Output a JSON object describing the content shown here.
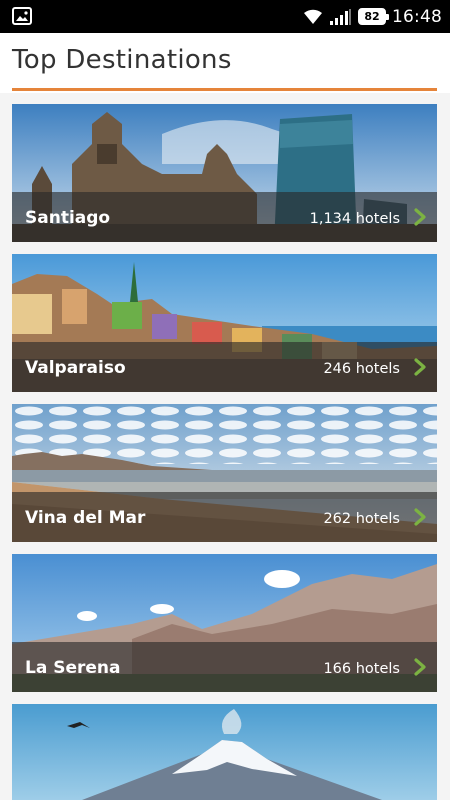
{
  "status_bar": {
    "time": "16:48",
    "battery": "82",
    "left_icon": "image-icon",
    "wifi_icon": "wifi-icon",
    "signal_icon": "signal-icon"
  },
  "header": {
    "title": "Top Destinations",
    "accent_color": "#e5843a"
  },
  "destinations": [
    {
      "name": "Santiago",
      "hotels": "1,134 hotels",
      "chevron_icon": "chevron-right-icon"
    },
    {
      "name": "Valparaiso",
      "hotels": "246 hotels",
      "chevron_icon": "chevron-right-icon"
    },
    {
      "name": "Vina del Mar",
      "hotels": "262 hotels",
      "chevron_icon": "chevron-right-icon"
    },
    {
      "name": "La Serena",
      "hotels": "166 hotels",
      "chevron_icon": "chevron-right-icon"
    },
    {
      "name": "",
      "hotels": "",
      "chevron_icon": ""
    }
  ],
  "colors": {
    "chevron": "#7cb342",
    "overlay": "rgba(40,40,40,0.62)"
  }
}
